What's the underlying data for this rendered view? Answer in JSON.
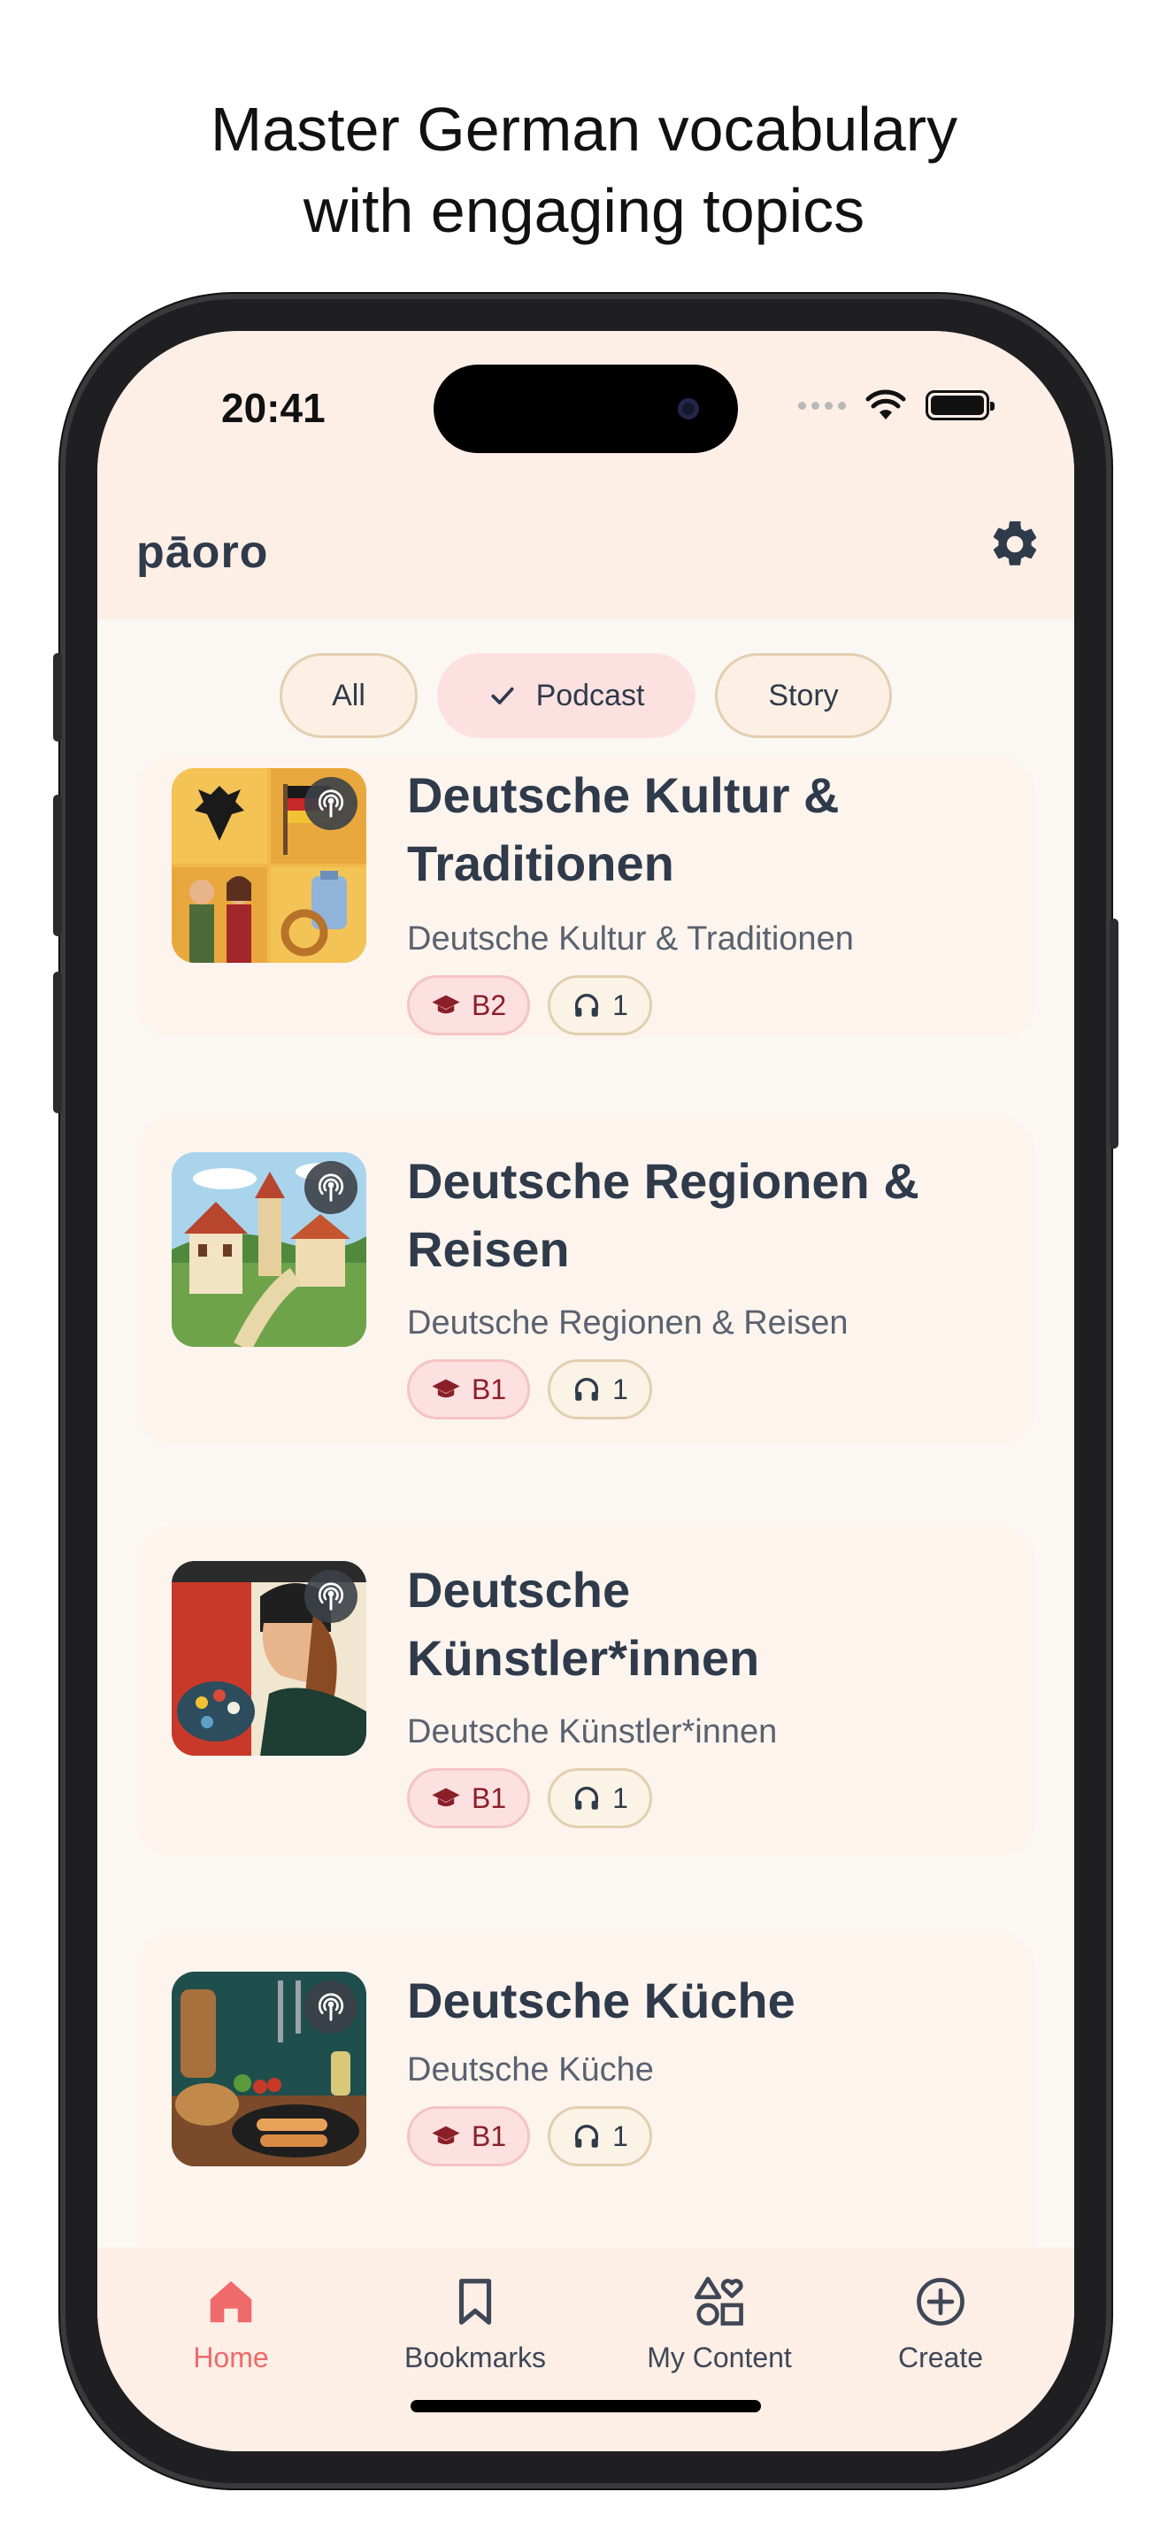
{
  "headline": {
    "line1": "Master German vocabulary",
    "line2": "with engaging topics"
  },
  "status_bar": {
    "time": "20:41"
  },
  "app": {
    "title": "pāoro"
  },
  "filters": [
    {
      "label": "All",
      "selected": false
    },
    {
      "label": "Podcast",
      "selected": true
    },
    {
      "label": "Story",
      "selected": false
    }
  ],
  "cards": [
    {
      "title": "Deutsche Kultur & Traditionen",
      "subtitle": "Deutsche Kultur & Traditionen",
      "level": "B2",
      "count": "1"
    },
    {
      "title": "Deutsche Regionen & Reisen",
      "subtitle": "Deutsche Regionen & Reisen",
      "level": "B1",
      "count": "1"
    },
    {
      "title": "Deutsche Künstler*innen",
      "subtitle": "Deutsche Künstler*innen",
      "level": "B1",
      "count": "1"
    },
    {
      "title": "Deutsche Küche",
      "subtitle": "Deutsche Küche",
      "level": "B1",
      "count": "1"
    }
  ],
  "nav": [
    {
      "label": "Home",
      "icon": "home-icon",
      "active": true
    },
    {
      "label": "Bookmarks",
      "icon": "bookmark-icon",
      "active": false
    },
    {
      "label": "My Content",
      "icon": "shapes-icon",
      "active": false
    },
    {
      "label": "Create",
      "icon": "plus-circle-icon",
      "active": false
    }
  ],
  "colors": {
    "accent": "#ef6a6a",
    "header_bg": "#fdeee6",
    "card_bg": "#fdf4ee",
    "text": "#2f3a4a"
  }
}
